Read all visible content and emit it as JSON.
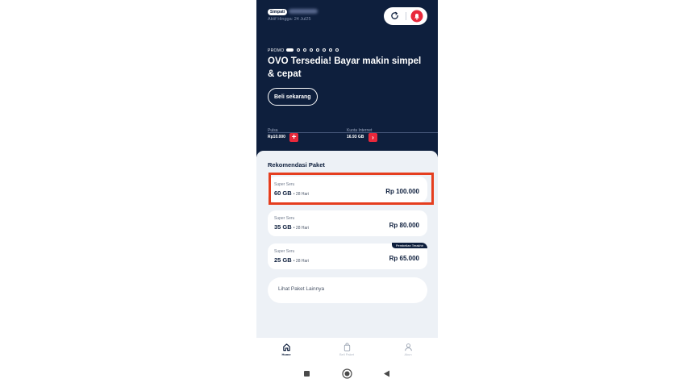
{
  "header": {
    "badge": "Simpati",
    "active_until": "Aktif Hingga: 24 Jul25",
    "promo_label": "PROMO",
    "promo_title": "OVO Tersedia! Bayar makin simpel & cepat",
    "buy_button": "Beli sekarang",
    "dots_total": 8,
    "dots_active_index": 0
  },
  "balance": {
    "pulsa_label": "Pulsa",
    "pulsa_value": "Rp10.000",
    "kuota_label": "Kuota Internet",
    "kuota_value": "16.93 GB"
  },
  "recommend": {
    "title": "Rekomendasi Paket",
    "packages": [
      {
        "category": "Super Seru",
        "size": "60 GB",
        "duration": "• 28 Hari",
        "price": "Rp 100.000",
        "tag": ""
      },
      {
        "category": "Super Seru",
        "size": "35 GB",
        "duration": "• 28 Hari",
        "price": "Rp 80.000",
        "tag": ""
      },
      {
        "category": "Super Seru",
        "size": "25 GB",
        "duration": "• 28 Hari",
        "price": "Rp 65.000",
        "tag": "Pembelian Terakhir"
      }
    ],
    "more_label": "Lihat Paket Lainnya"
  },
  "nav": {
    "home": "Home",
    "beli_paket": "Beli Paket",
    "akun": "Akun"
  },
  "colors": {
    "navy": "#0e1f3d",
    "accent_red": "#e8283b",
    "highlight": "#e53e1f",
    "content_bg": "#edf1f6"
  }
}
